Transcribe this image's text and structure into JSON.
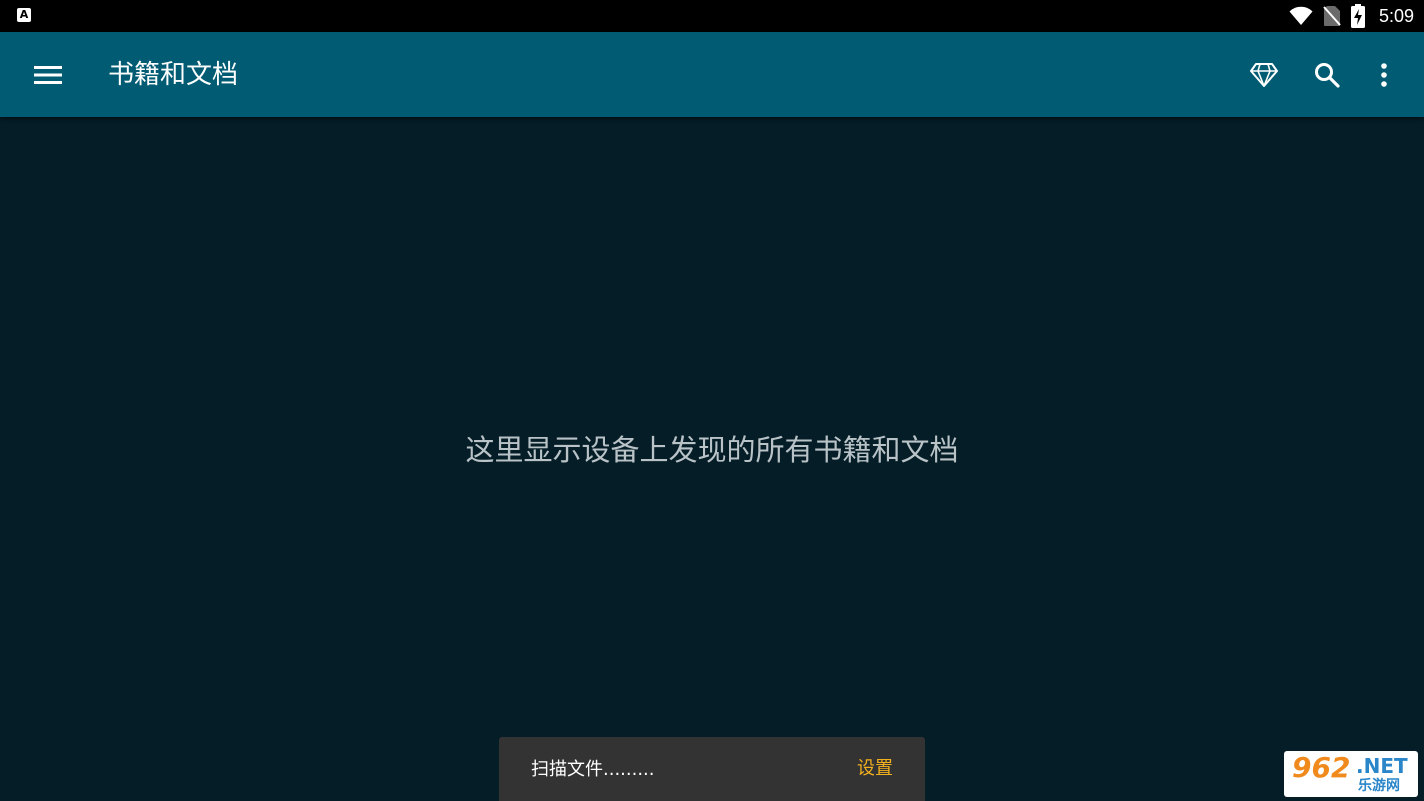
{
  "status_bar": {
    "notification_icon": "a-badge-icon",
    "notification_letter": "A",
    "time": "5:09",
    "icons": [
      "wifi-icon",
      "no-sim-icon",
      "battery-charging-icon"
    ]
  },
  "app_bar": {
    "title": "书籍和文档",
    "actions": [
      "menu-icon",
      "diamond-icon",
      "search-icon",
      "more-vert-icon"
    ]
  },
  "main": {
    "empty_message": "这里显示设备上发现的所有书籍和文档"
  },
  "snackbar": {
    "message": "扫描文件.........",
    "action_label": "设置",
    "action_color": "#f2b01e"
  },
  "watermark": {
    "number": "962",
    "suffix": ".NET",
    "chinese": "乐游网"
  },
  "colors": {
    "status_bar": "#000000",
    "app_bar": "#005b73",
    "background": "#041d26",
    "snackbar": "#333333"
  }
}
